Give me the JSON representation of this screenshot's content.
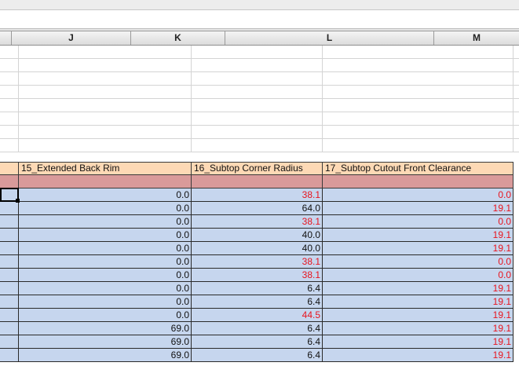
{
  "columns": [
    "J",
    "K",
    "L",
    "M"
  ],
  "header_row": {
    "col_j": "15_Extended Back Rim",
    "col_k": "16_Subtop Corner Radius",
    "col_l": "17_Subtop Cutout Front Clearance"
  },
  "rows": [
    {
      "j": "0.0",
      "k": "38.1",
      "l": "0.0",
      "k_red": true,
      "l_red": true
    },
    {
      "j": "0.0",
      "k": "64.0",
      "l": "19.1",
      "k_red": false,
      "l_red": true
    },
    {
      "j": "0.0",
      "k": "38.1",
      "l": "0.0",
      "k_red": true,
      "l_red": true
    },
    {
      "j": "0.0",
      "k": "40.0",
      "l": "19.1",
      "k_red": false,
      "l_red": true
    },
    {
      "j": "0.0",
      "k": "40.0",
      "l": "19.1",
      "k_red": false,
      "l_red": true
    },
    {
      "j": "0.0",
      "k": "38.1",
      "l": "0.0",
      "k_red": true,
      "l_red": true
    },
    {
      "j": "0.0",
      "k": "38.1",
      "l": "0.0",
      "k_red": true,
      "l_red": true
    },
    {
      "j": "0.0",
      "k": "6.4",
      "l": "19.1",
      "k_red": false,
      "l_red": true
    },
    {
      "j": "0.0",
      "k": "6.4",
      "l": "19.1",
      "k_red": false,
      "l_red": true
    },
    {
      "j": "0.0",
      "k": "44.5",
      "l": "19.1",
      "k_red": true,
      "l_red": true
    },
    {
      "j": "69.0",
      "k": "6.4",
      "l": "19.1",
      "k_red": false,
      "l_red": true
    },
    {
      "j": "69.0",
      "k": "6.4",
      "l": "19.1",
      "k_red": false,
      "l_red": true
    },
    {
      "j": "69.0",
      "k": "6.4",
      "l": "19.1",
      "k_red": false,
      "l_red": true
    }
  ],
  "colors": {
    "header_fill": "#fdd9b5",
    "pink_fill": "#d99a9a",
    "data_fill": "#c6d6ee",
    "red_text": "#e8141e"
  }
}
